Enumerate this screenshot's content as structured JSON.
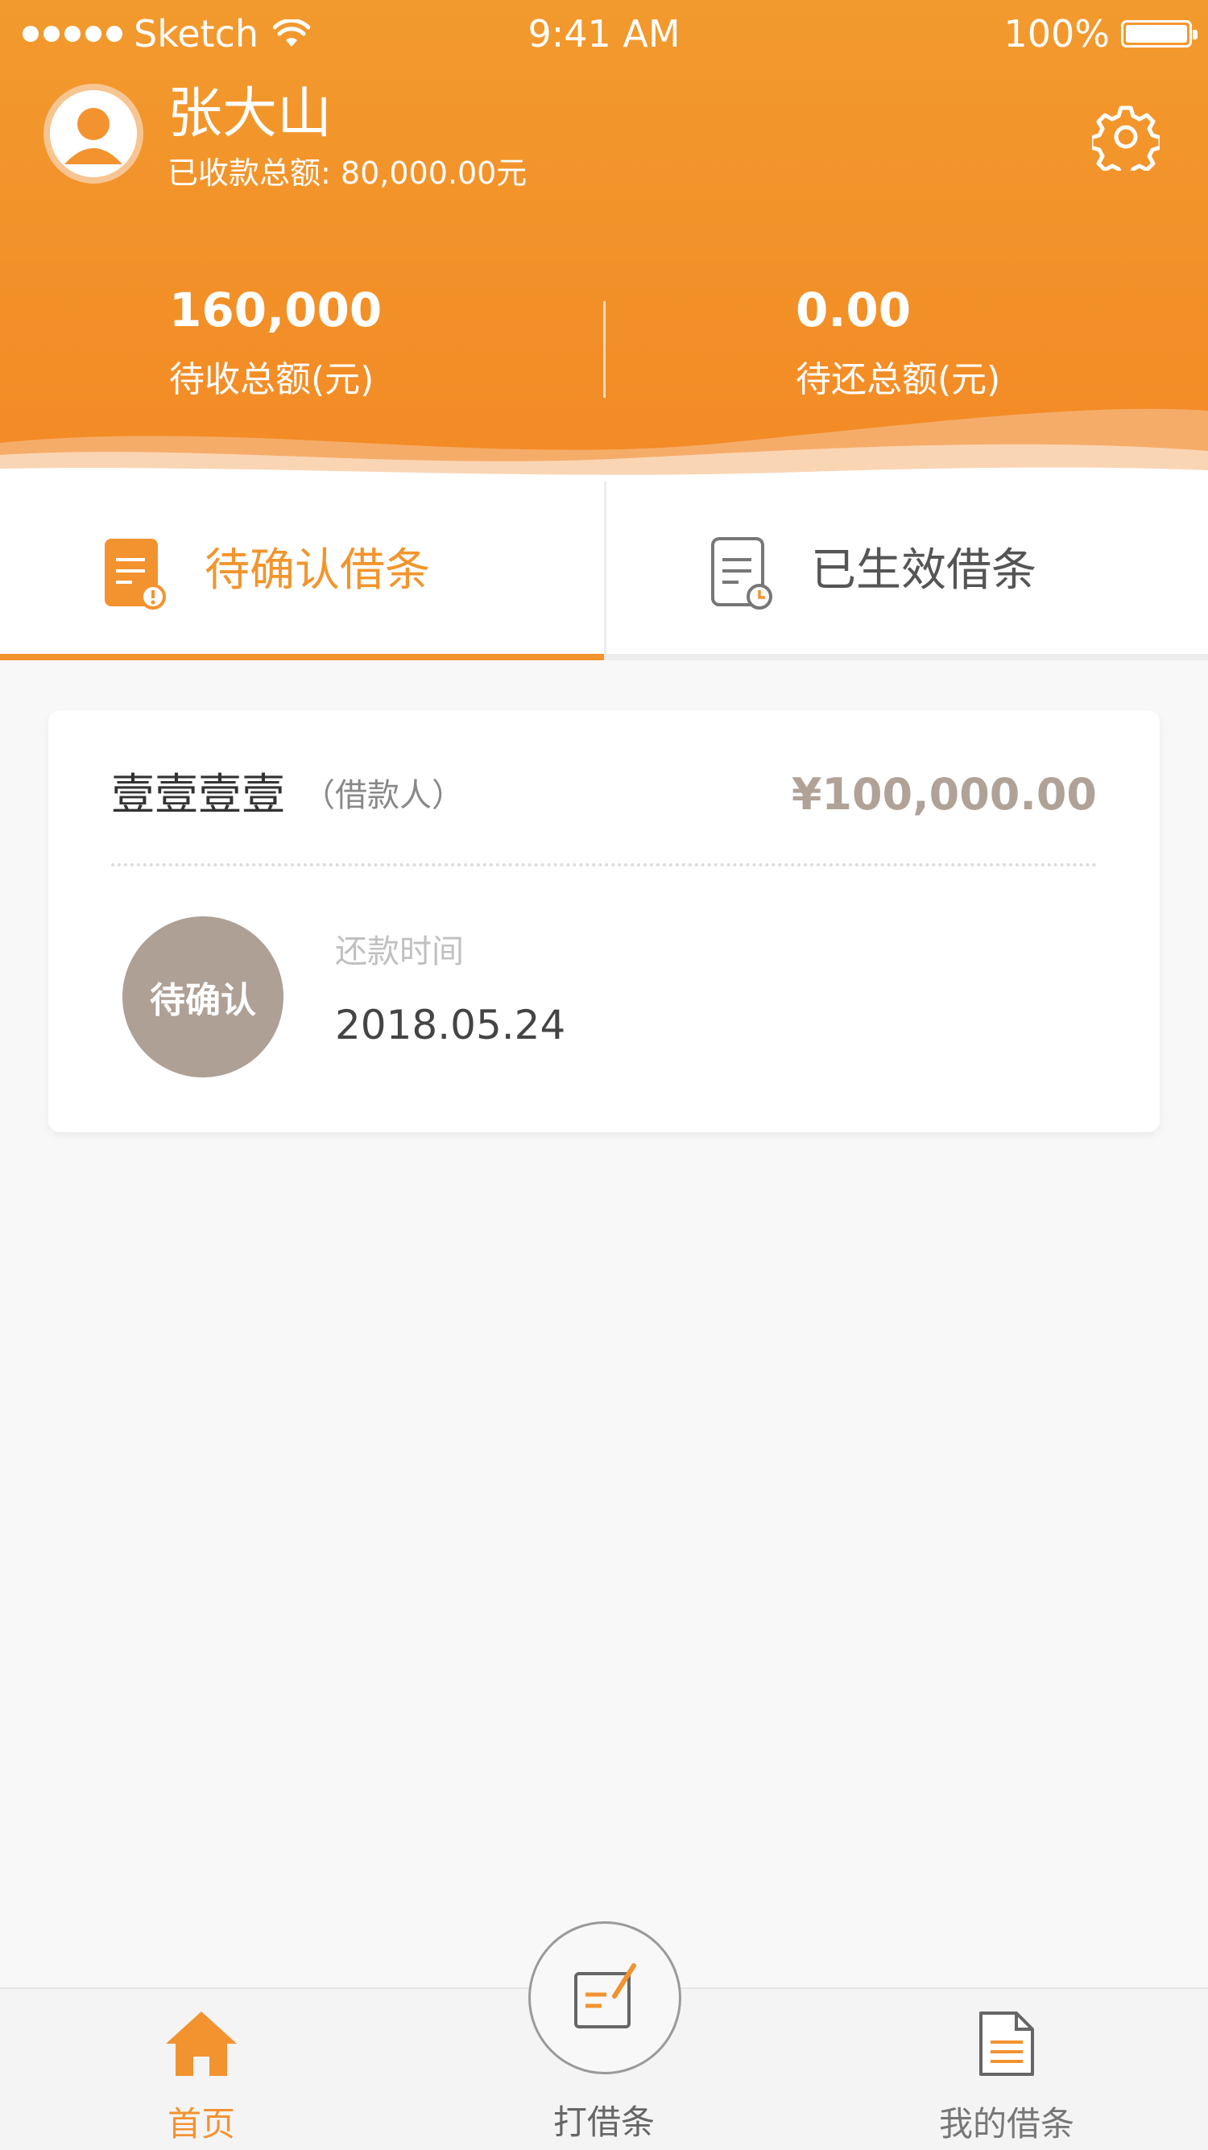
{
  "status_bar": {
    "carrier": "Sketch",
    "time": "9:41 AM",
    "battery": "100%"
  },
  "profile": {
    "name": "张大山",
    "collected_label": "已收款总额:",
    "collected_value": "80,000.00元",
    "settings_icon": "gear-icon",
    "avatar_icon": "user-avatar-icon"
  },
  "stats": {
    "receivable_value": "160,000",
    "receivable_label": "待收总额(元)",
    "payable_value": "0.00",
    "payable_label": "待还总额(元)"
  },
  "tabs": [
    {
      "label": "待确认借条",
      "icon": "pending-note-icon",
      "active": true
    },
    {
      "label": "已生效借条",
      "icon": "effective-note-icon",
      "active": false
    }
  ],
  "card": {
    "name": "壹壹壹壹",
    "role": "（借款人）",
    "amount": "¥100,000.00",
    "status": "待确认",
    "due_label": "还款时间",
    "due_date": "2018.05.24"
  },
  "bottom_nav": {
    "home": "首页",
    "write": "打借条",
    "mine": "我的借条"
  },
  "colors": {
    "accent": "#f29330",
    "header": "#f38a25",
    "badge": "#aea095",
    "amount": "#b0a296"
  }
}
